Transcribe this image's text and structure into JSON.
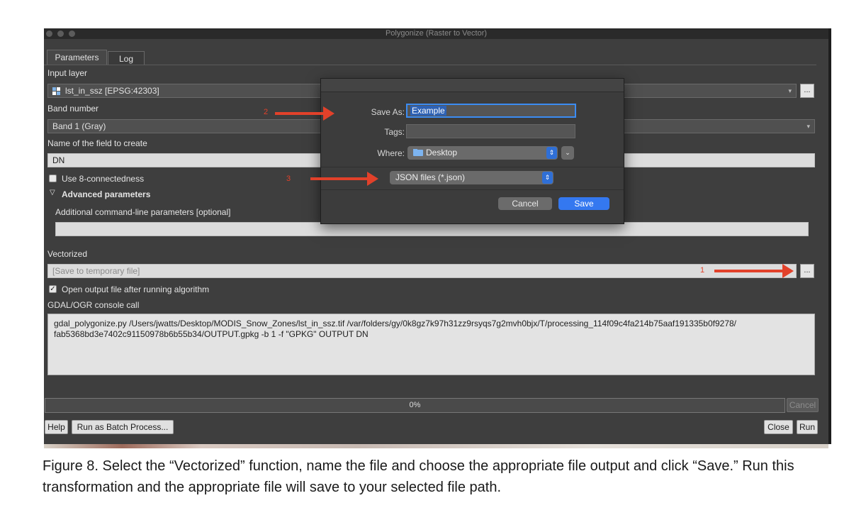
{
  "window": {
    "title": "Polygonize (Raster to Vector)"
  },
  "tabs": [
    {
      "label": "Parameters",
      "active": true
    },
    {
      "label": "Log",
      "active": false
    }
  ],
  "form": {
    "input_layer_label": "Input layer",
    "input_layer_value": "lst_in_ssz [EPSG:42303]",
    "band_label": "Band number",
    "band_value": "Band 1 (Gray)",
    "field_name_label": "Name of the field to create",
    "field_name_value": "DN",
    "connectedness_label": "Use 8-connectedness",
    "advanced_label": "Advanced parameters",
    "additional_params_label": "Additional command-line parameters [optional]",
    "additional_params_value": "",
    "vectorized_label": "Vectorized",
    "vectorized_placeholder": "[Save to temporary file]",
    "open_output_label": "Open output file after running algorithm",
    "console_label": "GDAL/OGR console call",
    "console_text": "gdal_polygonize.py /Users/jwatts/Desktop/MODIS_Snow_Zones/lst_in_ssz.tif /var/folders/gy/0k8gz7k97h31zz9rsyqs7g2mvh0bjx/T/processing_114f09c4fa214b75aaf191335b0f9278/ fab5368bd3e7402c91150978b6b55b34/OUTPUT.gpkg -b 1 -f \"GPKG\" OUTPUT DN",
    "browse_label": "...",
    "check_mark": "✓"
  },
  "footer": {
    "progress_text": "0%",
    "progress_fraction": 0,
    "cancel_label": "Cancel",
    "help_label": "Help",
    "batch_label": "Run as Batch Process...",
    "close_label": "Close",
    "run_label": "Run"
  },
  "save_dialog": {
    "save_as_label": "Save As:",
    "save_as_value": "Example",
    "tags_label": "Tags:",
    "where_label": "Where:",
    "where_value": "Desktop",
    "format_value": "JSON files (*.json)",
    "cancel_label": "Cancel",
    "save_label": "Save"
  },
  "annotations": {
    "one": "1",
    "two": "2",
    "three": "3",
    "color": "#e2412a"
  },
  "caption": "Figure 8. Select the “Vectorized” function, name the file and choose the appropriate file output and click “Save.” Run this transformation and the appropriate file will save to your selected file path.",
  "icons": {
    "layer": "raster-layer-icon",
    "folder": "folder-icon",
    "stepper": "updown-stepper-icon"
  }
}
